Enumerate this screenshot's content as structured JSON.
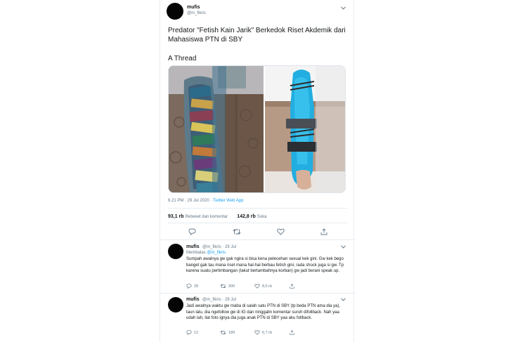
{
  "tweet": {
    "name": "mufis",
    "handle": "@m_fikris",
    "text": "Predator \"Fetish Kain Jarik\" Berkedok Riset Akdemik dari Mahasiswa PTN di SBY",
    "thread_label": "A Thread",
    "time": "6.21 PM · 29 Jul 2020 · ",
    "app": "Twitter Web App",
    "retweets_count": "93,1 rb",
    "retweets_label": "Retweet dan komentar",
    "likes_count": "142,8 rb",
    "likes_label": "Suka"
  },
  "replies": [
    {
      "name": "mufis",
      "handle": "@m_fikris · 29 Jul",
      "replying_prefix": "Membalas",
      "replying_to": "@m_fikris",
      "text": "Sumpah awalnya gw gak ngira si bisa kena pelecehan sexual kek gini. Gw kek bego banget gak tau mana riset mana hal-hal berbau fetish gini, rada shock juga si gw. Tp karena suatu pertimbangan (takut bertambahnya korban) gw jadi berani speak up.",
      "reply_count": "28",
      "retweet_count": "300",
      "like_count": "8,5 rb"
    },
    {
      "name": "mufis",
      "handle": "@m_fikris · 29 Jul",
      "text": "Jadi awalnya waktu gw maba di salah satu PTN di SBY (tp beda PTN ama dia ya), taun lalu, dia ngefollow gw di IG dan ninggalin komentar suruh difollback. Nah yaa udah lah, liat foto ignya dia juga anak PTN di SBY yaa aku follback.",
      "reply_count": "12",
      "retweet_count": "189",
      "like_count": "6,7 rb"
    }
  ],
  "icons": [
    "chevron-down-icon",
    "reply-icon",
    "retweet-icon",
    "like-icon",
    "share-icon"
  ],
  "colors": {
    "link": "#1da1f2",
    "muted": "#657786",
    "text": "#14171a",
    "border": "#e6ecf0"
  }
}
